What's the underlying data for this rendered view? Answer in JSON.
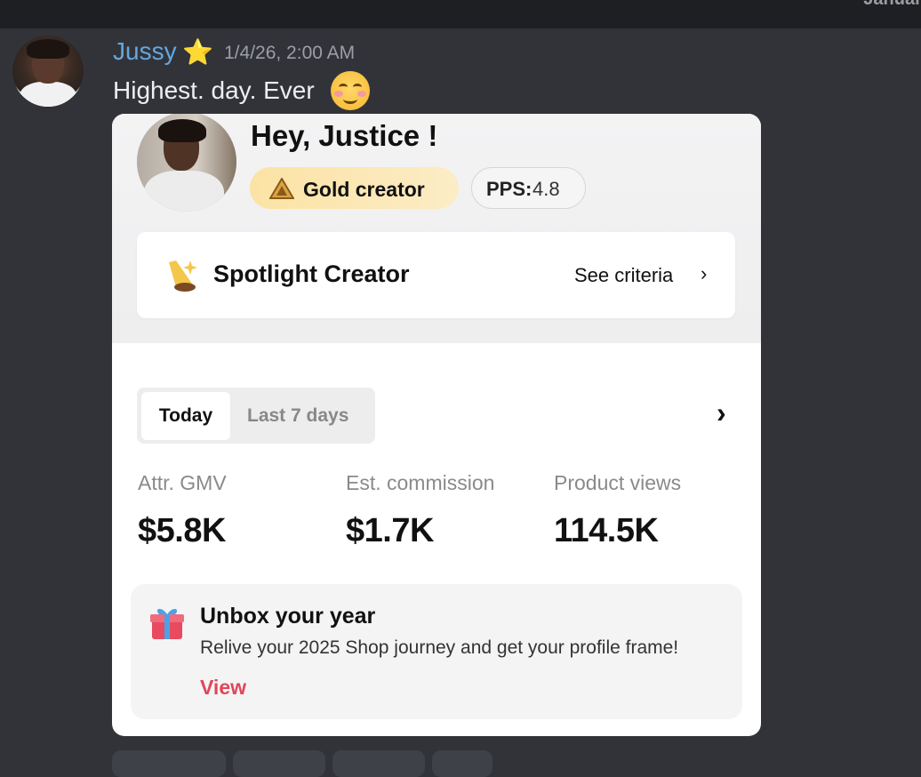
{
  "header": {
    "date_divider": "January"
  },
  "message": {
    "username": "Jussy",
    "username_emoji": "⭐",
    "timestamp": "1/4/26, 2:00 AM",
    "text": "Highest. day. Ever",
    "emoji": "smiling-face-with-blush"
  },
  "card": {
    "greeting": "Hey, Justice !",
    "badge_gold": "Gold creator",
    "pps_label": "PPS:",
    "pps_value": "4.8",
    "spotlight_title": "Spotlight Creator",
    "spotlight_link": "See criteria",
    "spotlight_chevron": "›",
    "tabs": {
      "today": "Today",
      "last7": "Last 7 days"
    },
    "more_chevron": "›",
    "stats": [
      {
        "label": "Attr. GMV",
        "value": "$5.8K"
      },
      {
        "label": "Est. commission",
        "value": "$1.7K"
      },
      {
        "label": "Product views",
        "value": "114.5K"
      }
    ],
    "unbox": {
      "title": "Unbox your year",
      "description": "Relive your 2025 Shop journey and get your profile frame!",
      "action": "View"
    }
  },
  "colors": {
    "username": "#62a8e0",
    "view_link": "#e0465a",
    "gold_badge": "#fbe3a4"
  }
}
